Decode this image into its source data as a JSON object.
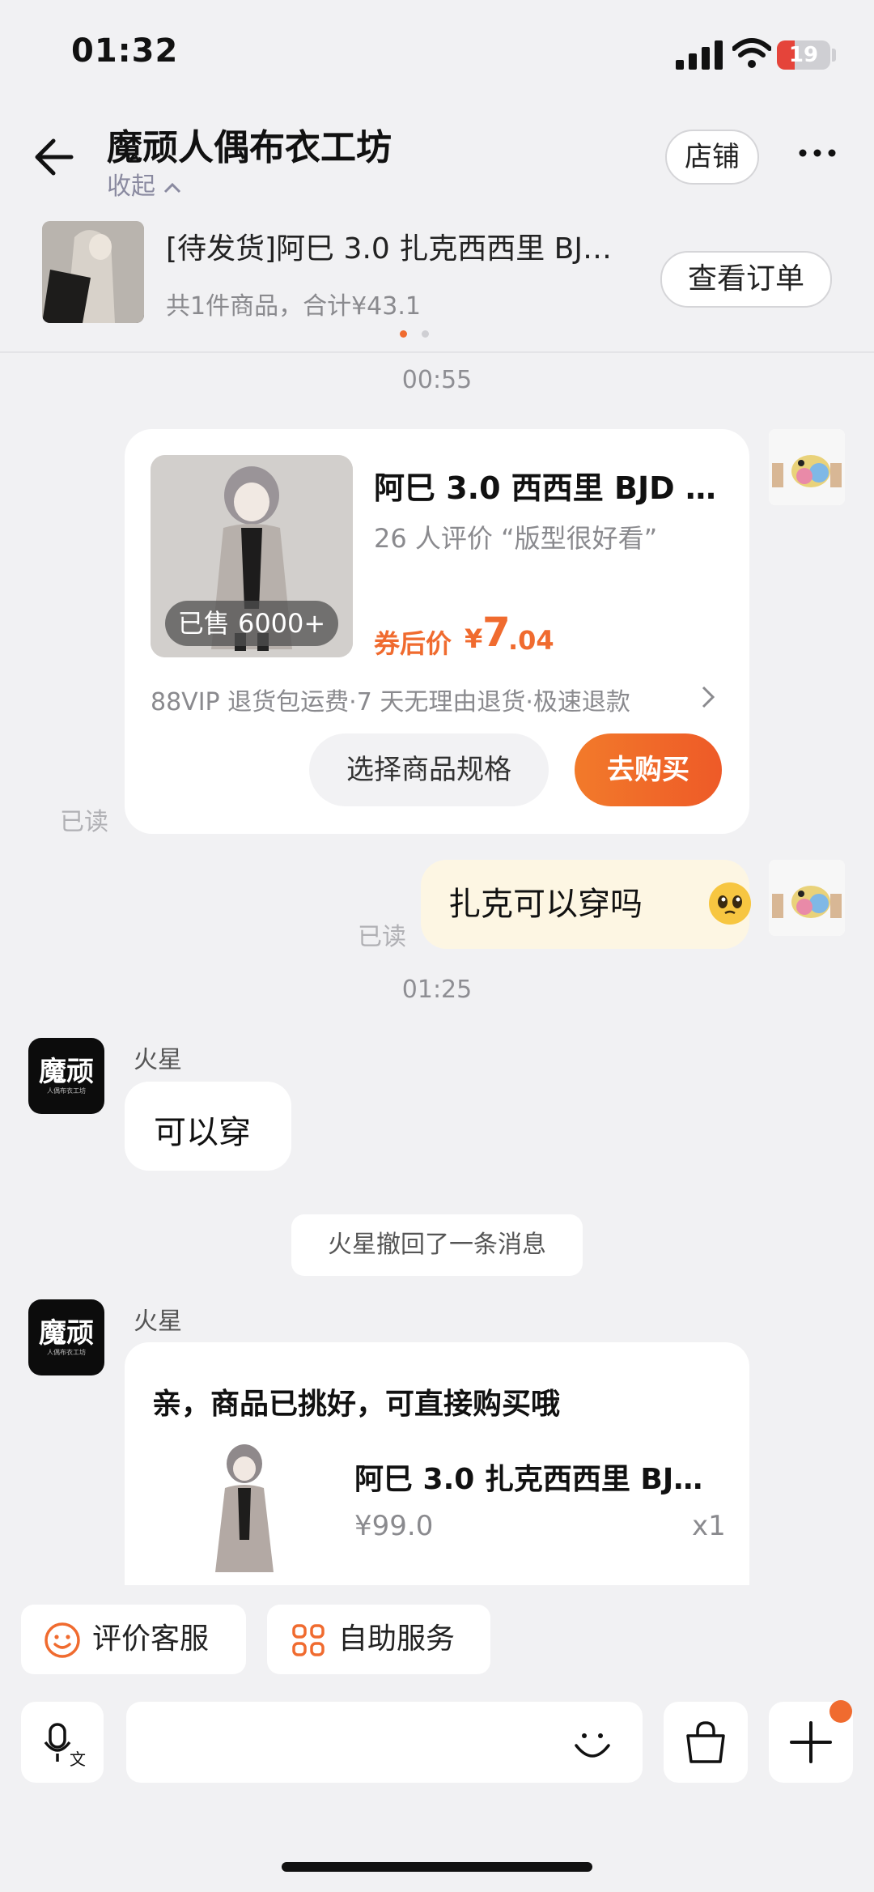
{
  "status_bar": {
    "time": "01:32",
    "battery": "19"
  },
  "header": {
    "title": "魔顽人偶布衣工坊",
    "collapse_label": "收起",
    "shop_button": "店铺"
  },
  "order": {
    "title": "[待发货]阿巳 3.0 扎克西西里 BJ…",
    "summary": "共1件商品，合计¥43.1",
    "view_button": "查看订单"
  },
  "chat": {
    "time1": "00:55",
    "product_card": {
      "title": "阿巳 3.0 西西里 BJD …",
      "reviews": "26 人评价 “版型很好看”",
      "sold": "已售 6000+",
      "price_label": "券后价",
      "price_currency": "¥",
      "price_int": "7",
      "price_dec": ".04",
      "service": "88VIP 退货包运费·7 天无理由退货·极速退款",
      "spec_button": "选择商品规格",
      "buy_button": "去购买",
      "read": "已读"
    },
    "my_message": {
      "text": "扎克可以穿吗",
      "read": "已读"
    },
    "time2": "01:25",
    "reply1": {
      "sender": "火星",
      "text": "可以穿"
    },
    "recall_notice": "火星撤回了一条消息",
    "reply2": {
      "sender": "火星",
      "text": "亲，商品已挑好，可直接购买哦",
      "item_title": "阿巳 3.0 扎克西西里 BJ…",
      "item_price": "¥99.0",
      "item_qty": "x1"
    },
    "shop_avatar_logo": "魔顽",
    "shop_avatar_sub": "人偶布衣工坊"
  },
  "quick_actions": [
    {
      "label": "评价客服",
      "icon": "smile-icon"
    },
    {
      "label": "自助服务",
      "icon": "grid-icon"
    }
  ],
  "colors": {
    "accent": "#f06b2f",
    "bg": "#f1f1f3"
  }
}
